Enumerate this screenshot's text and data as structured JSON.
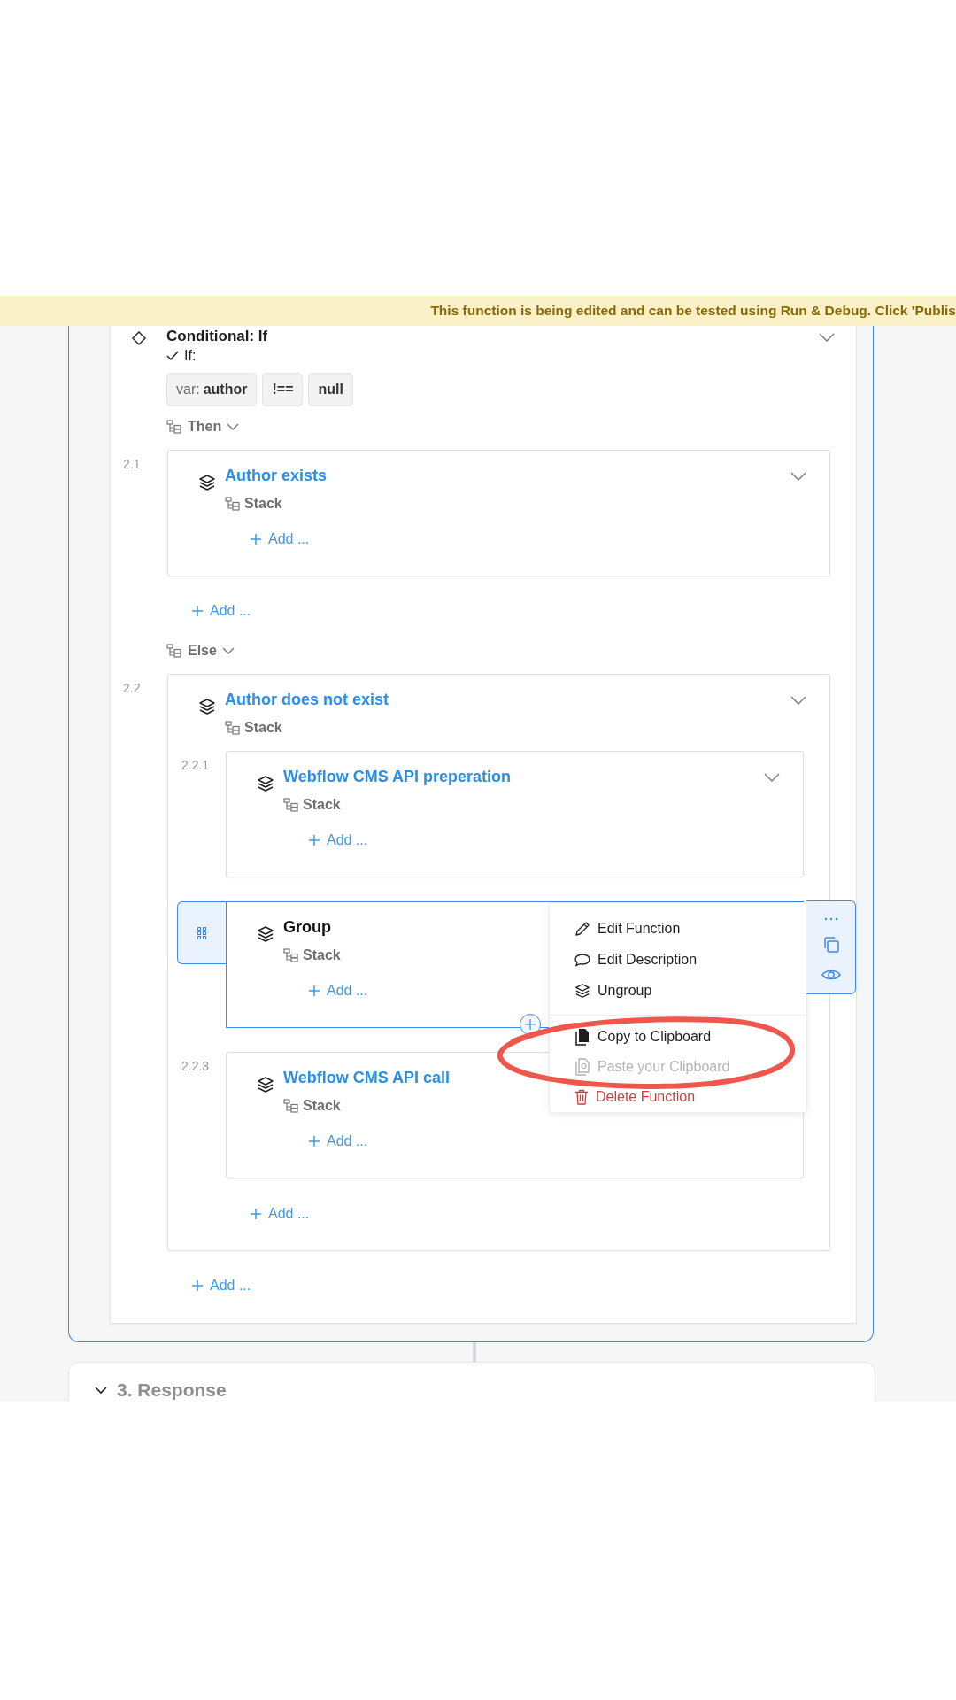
{
  "banner": {
    "text": "This function is being edited and can be tested using Run & Debug. Click 'Publis"
  },
  "conditional": {
    "title": "Conditional: If",
    "condition_label": "If:",
    "condition": [
      {
        "text": "var: **author**"
      },
      {
        "text": "!=="
      },
      {
        "text": "null"
      }
    ],
    "branches": [
      {
        "label": "Then",
        "add_label": "Add ...",
        "steps": [
          {
            "number": "2.1",
            "title": "Author exists",
            "type": "Stack",
            "selected": false,
            "collapsible": true,
            "add_label": "Add ..."
          }
        ]
      },
      {
        "label": "Else",
        "add_label": "Add ...",
        "steps": [
          {
            "number": "2.2",
            "title": "Author does not exist",
            "type": "Stack",
            "selected": false,
            "collapsible": true,
            "add_label": "Add ...",
            "children": [
              {
                "number": "2.2.1",
                "title": "Webflow CMS API preperation",
                "type": "Stack",
                "selected": false,
                "collapsible": true,
                "add_label": "Add ..."
              },
              {
                "title": "Group",
                "type": "Stack",
                "selected": true,
                "collapsible": false,
                "add_label": "Add ..."
              },
              {
                "number": "2.2.3",
                "title": "Webflow CMS API call",
                "type": "Stack",
                "selected": false,
                "add_label": "Add ..."
              }
            ]
          }
        ]
      }
    ]
  },
  "menu": {
    "groups": [
      {
        "items": [
          {
            "label": "Edit Function",
            "kind": "normal",
            "disabled": false
          },
          {
            "label": "Edit Description",
            "kind": "normal",
            "disabled": false
          },
          {
            "label": "Ungroup",
            "kind": "normal",
            "disabled": false
          }
        ]
      },
      {
        "items": [
          {
            "label": "Copy to Clipboard",
            "kind": "normal",
            "disabled": false
          },
          {
            "label": "Paste your Clipboard",
            "kind": "normal",
            "disabled": true
          },
          {
            "label": "Delete Function",
            "kind": "danger",
            "disabled": false
          }
        ]
      }
    ]
  },
  "sections": [
    {
      "title": "3. Response",
      "expanded": true
    }
  ]
}
